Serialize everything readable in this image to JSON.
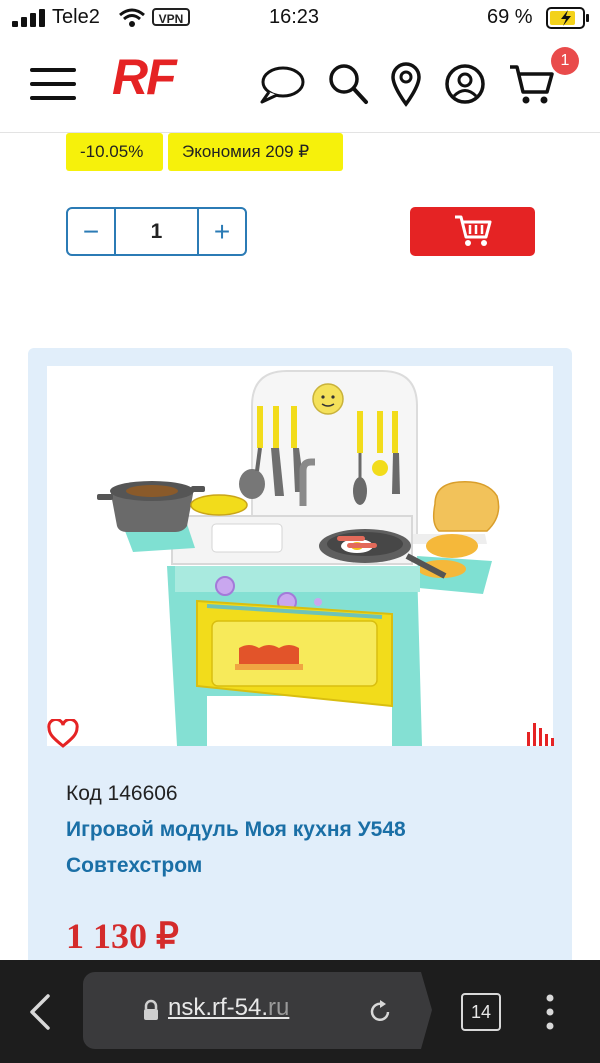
{
  "status_bar": {
    "carrier": "Tele2",
    "vpn": "VPN",
    "time": "16:23",
    "battery": "69 %"
  },
  "header": {
    "logo": "RF",
    "cart_count": "1",
    "icons": [
      "menu-icon",
      "chat-icon",
      "search-icon",
      "location-icon",
      "account-icon",
      "cart-icon"
    ]
  },
  "promo": {
    "discount": "-10.05%",
    "savings": "Экономия 209 ₽"
  },
  "quantity": {
    "minus": "−",
    "value": "1",
    "plus": "+"
  },
  "product": {
    "code": "Код 146606",
    "title": "Игровой модуль Моя кухня У548 Совтехстром",
    "price": "1 130 ₽"
  },
  "browser": {
    "url_main": "nsk.rf-54.",
    "url_suffix": "ru",
    "tabs": "14"
  },
  "colors": {
    "brand_red": "#e52324",
    "link_blue": "#1a6fa6",
    "tag_yellow": "#f6f10b",
    "card_bg": "#e1eefa"
  }
}
